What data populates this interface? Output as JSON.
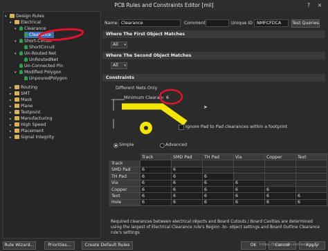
{
  "window": {
    "title": "PCB Rules and Constraints Editor [mil]",
    "help": "?",
    "close": "×"
  },
  "tree": {
    "design_rules": "Design Rules",
    "electrical": "Electrical",
    "clearance": "Clearance",
    "clearance_rule": "Clearance",
    "short_circuit": "Short-Circuit",
    "short_circuit_rule": "ShortCircuit",
    "unrouted_net": "Un-Routed Net",
    "unrouted_net_rule": "UnRoutedNet",
    "unconnected_pin": "Un-Connected Pin",
    "modified_polygon": "Modified Polygon",
    "unpoured_polygon": "UnpouredPolygon",
    "routing": "Routing",
    "smt": "SMT",
    "mask": "Mask",
    "plane": "Plane",
    "testpoint": "Testpoint",
    "manufacturing": "Manufacturing",
    "high_speed": "High Speed",
    "placement": "Placement",
    "signal_integrity": "Signal Integrity"
  },
  "header": {
    "name_label": "Name",
    "name_value": "Clearance",
    "comment_label": "Comment",
    "comment_value": "",
    "uid_label": "Unique ID",
    "uid_value": "NMFCFDCA",
    "test_queries": "Test Queries"
  },
  "first_match": {
    "title": "Where The First Object Matches",
    "value": "All"
  },
  "second_match": {
    "title": "Where The Second Object Matches",
    "value": "All"
  },
  "constraints": {
    "title": "Constraints",
    "different_nets": "Different Nets Only",
    "min_clearance_label": "Minimum Clearance",
    "min_clearance_value": "6",
    "ignore_pad": "Ignore Pad to Pad clearances within a footprint",
    "simple": "Simple",
    "advanced": "Advanced"
  },
  "grid": {
    "columns": [
      "Track",
      "SMD Pad",
      "TH Pad",
      "Via",
      "Copper",
      "Text"
    ],
    "rows": [
      {
        "label": "Track",
        "cells": [
          "",
          null,
          null,
          null,
          null,
          null
        ]
      },
      {
        "label": "SMD Pad",
        "cells": [
          "6",
          "6",
          null,
          null,
          null,
          null
        ]
      },
      {
        "label": "TH Pad",
        "cells": [
          "6",
          "6",
          "6",
          null,
          null,
          null
        ]
      },
      {
        "label": "Via",
        "cells": [
          "6",
          "6",
          "6",
          "6",
          null,
          null
        ]
      },
      {
        "label": "Copper",
        "cells": [
          "6",
          "6",
          "6",
          "6",
          "6",
          null
        ]
      },
      {
        "label": "Text",
        "cells": [
          "6",
          "6",
          "6",
          "6",
          "6",
          "6"
        ]
      },
      {
        "label": "Hole",
        "cells": [
          "6",
          "6",
          "6",
          "6",
          "6",
          "6"
        ]
      }
    ]
  },
  "note": "Required clearances between electrical objects and Board Cutouts / Board Cavities are determined using the largest of Electrical Clearance rule's Region -to- object settings and Board Outline Clearance rule's settings.",
  "footer": {
    "rule_wizard": "Rule Wizard...",
    "priorities": "Priorities...",
    "create_default_rules": "Create Default Rules",
    "ok": "OK",
    "cancel": "Cancel",
    "apply": "Apply"
  },
  "watermark": "https://blog.csdn.net/weixin_43",
  "colors": {
    "highlight_circle": "#e0142a",
    "diagram_yellow": "#f2e600",
    "selection_blue": "#3b6fb6"
  }
}
